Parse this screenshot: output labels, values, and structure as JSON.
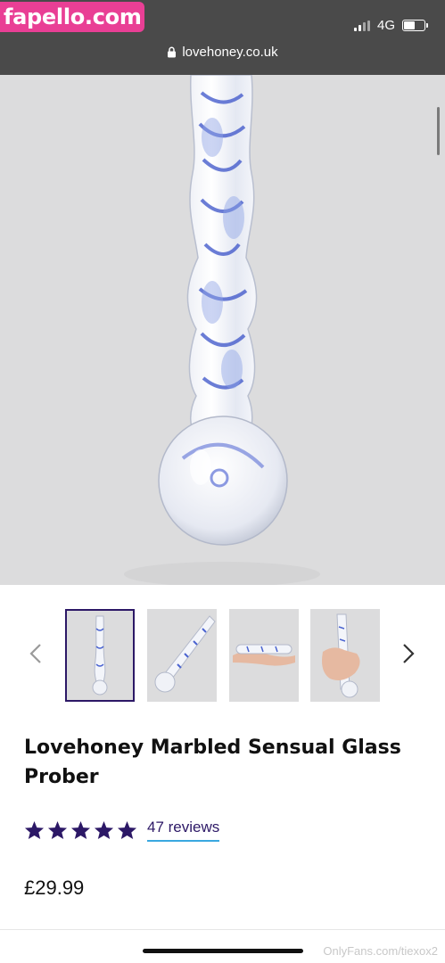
{
  "watermark_top": "fapello.com",
  "status": {
    "network": "4G"
  },
  "browser": {
    "url": "lovehoney.co.uk"
  },
  "gallery": {
    "thumbnails": [
      {
        "name": "upright-view",
        "selected": true
      },
      {
        "name": "diagonal-view",
        "selected": false
      },
      {
        "name": "hand-flat-view",
        "selected": false
      },
      {
        "name": "hand-grip-view",
        "selected": false
      }
    ]
  },
  "product": {
    "title": "Lovehoney Marbled Sensual Glass Prober",
    "rating_stars": 5,
    "reviews_label": "47 reviews",
    "price": "£29.99"
  },
  "watermark_bottom": "OnlyFans.com/tiexox2",
  "colors": {
    "brand_purple": "#2c1866",
    "link_underline": "#3aa8e0",
    "badge_pink": "#e93f95",
    "topbar": "#4a4a4a",
    "image_bg": "#dcdcdd"
  }
}
